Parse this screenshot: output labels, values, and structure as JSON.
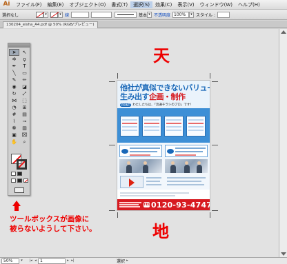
{
  "app": {
    "logo": "Ai"
  },
  "menubar": {
    "items": [
      "ファイル(F)",
      "編集(E)",
      "オブジェクト(O)",
      "書式(T)",
      "選択(S)",
      "効果(C)",
      "表示(V)",
      "ウィンドウ(W)",
      "ヘルプ(H)"
    ],
    "active_index": 4
  },
  "controlbar": {
    "selection_label": "選択なし",
    "stroke_label": "線",
    "stroke_style": "基本",
    "opacity_label": "不透明度",
    "opacity_value": "100%",
    "style_label": "スタイル :"
  },
  "document": {
    "tab_title": "130204_eisha_A4.pdf @ 50% (RGB/プレビュー)"
  },
  "canvas": {
    "top_label": "天",
    "bottom_label": "地",
    "instruction_line1": "ツールボックスが画像に",
    "instruction_line2": "被らないようして下さい。",
    "colors": {
      "accent_red": "#e00000"
    }
  },
  "flyer": {
    "headline_1": "他社が真似できないバリューを",
    "headline_2a": "生み出す",
    "headline_2b": "企画・制作",
    "tagline_badge": "POINT",
    "tagline": "わたしたちは、「流通チラシのプロ」です！",
    "phone_icon": "TEL",
    "phone": "0120-93-4747",
    "colors": {
      "blue": "#1a68b8",
      "red": "#d71a20",
      "band": "#3d8fd6"
    }
  },
  "statusbar": {
    "zoom": "50%",
    "page": "1",
    "tool": "選択"
  },
  "icons": {
    "toolbox": [
      "selection",
      "direct-selection",
      "magic-wand",
      "lasso",
      "pen",
      "type",
      "line",
      "rectangle",
      "paintbrush",
      "pencil",
      "blob-brush",
      "eraser",
      "rotate",
      "scale",
      "width",
      "free-transform",
      "shape-builder",
      "perspective",
      "mesh",
      "gradient",
      "eyedropper",
      "blend",
      "symbol-sprayer",
      "column-graph",
      "artboard",
      "slice",
      "hand",
      "zoom"
    ]
  }
}
